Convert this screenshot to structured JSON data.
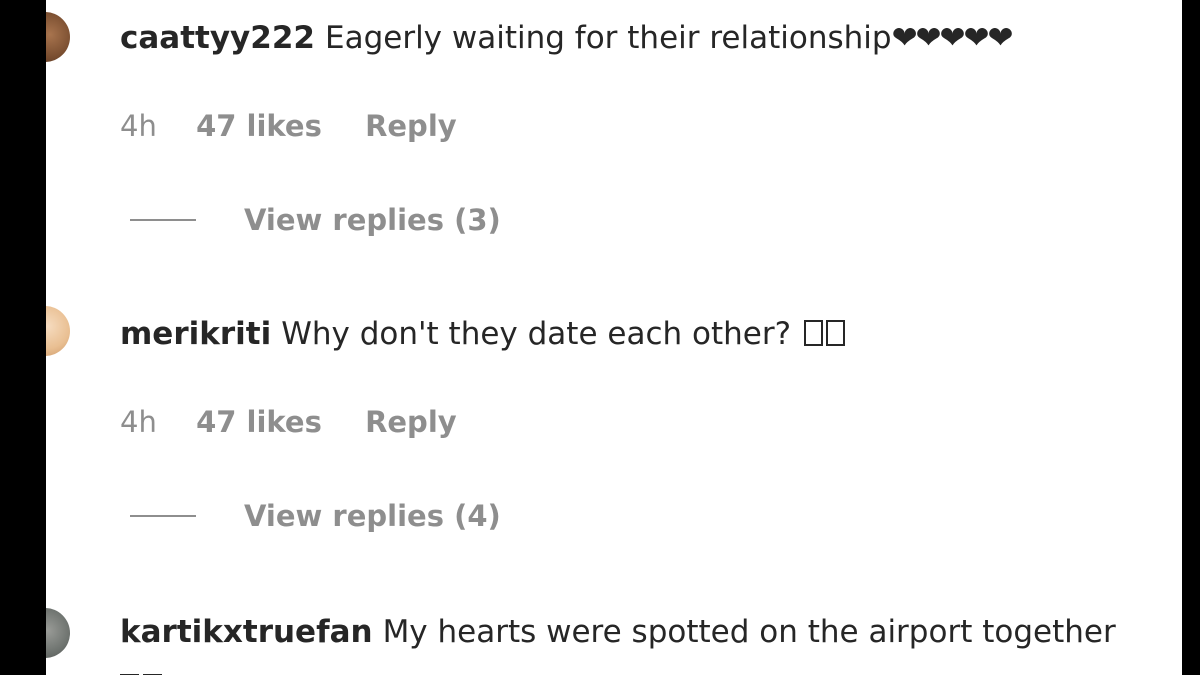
{
  "comments": [
    {
      "username": "caattyy222",
      "text": "Eagerly waiting for their relationship",
      "emoji": "❤❤❤❤❤",
      "time": "4h",
      "likes": "47 likes",
      "reply": "Reply",
      "view_replies": "View replies (3)"
    },
    {
      "username": "merikriti",
      "text": "Why don't they date each other?",
      "time": "4h",
      "likes": "47 likes",
      "reply": "Reply",
      "view_replies": "View replies (4)"
    },
    {
      "username": "kartikxtruefan",
      "text": "My hearts were spotted on the airport together"
    }
  ]
}
